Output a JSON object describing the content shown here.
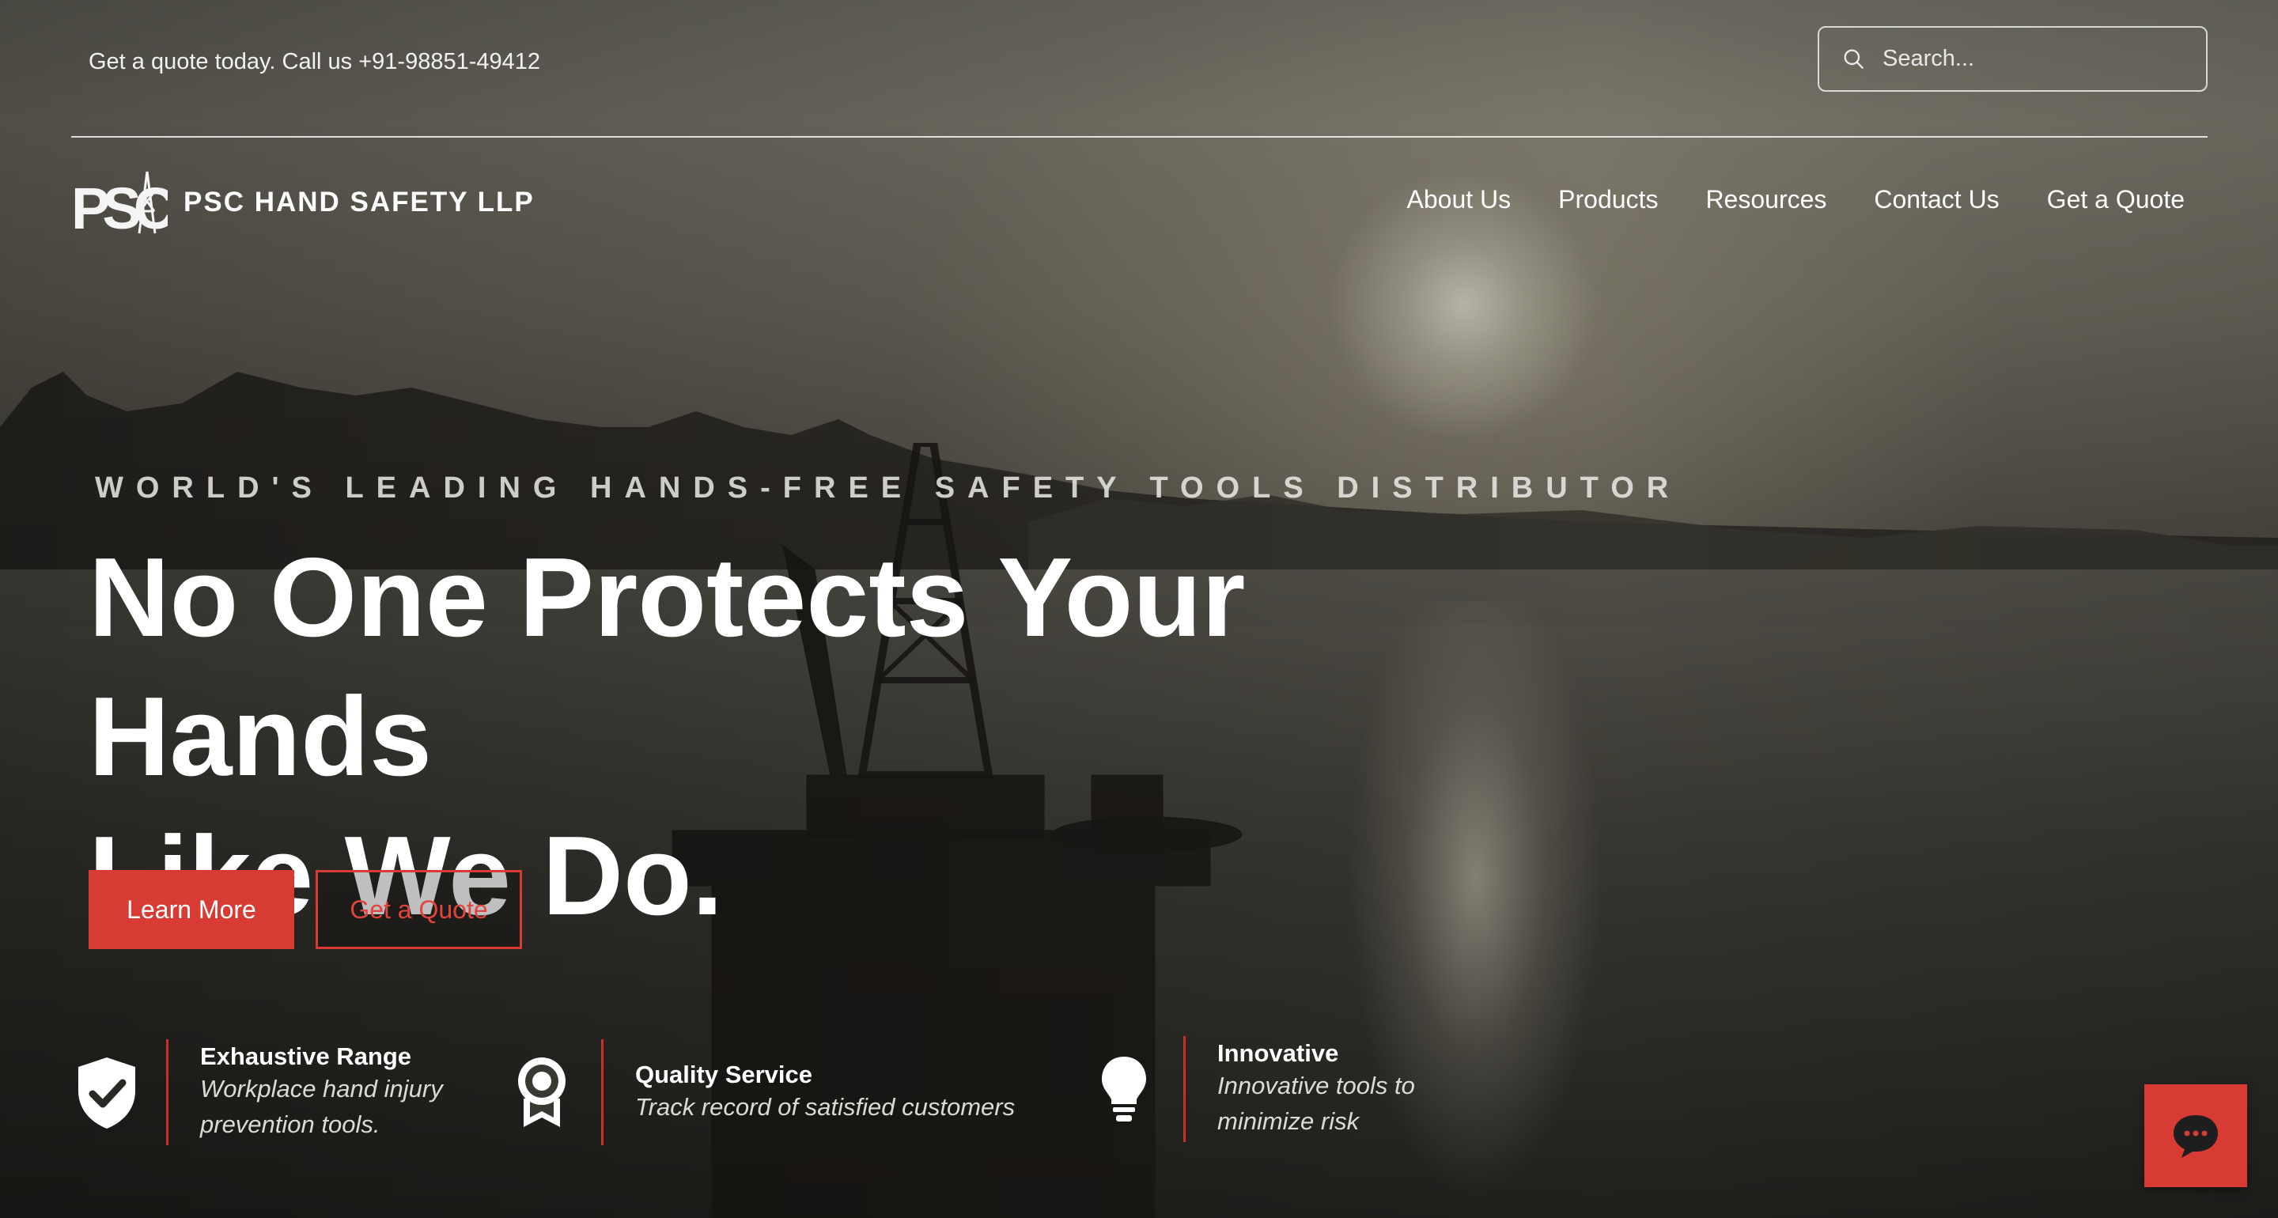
{
  "topbar": {
    "contact_text": "Get a quote today. Call us +91-98851-49412",
    "search_placeholder": "Search..."
  },
  "brand": {
    "logo_text": "PSC",
    "name": "PSC HAND SAFETY LLP"
  },
  "nav": {
    "items": [
      {
        "label": "About Us"
      },
      {
        "label": "Products"
      },
      {
        "label": "Resources"
      },
      {
        "label": "Contact Us"
      },
      {
        "label": "Get a Quote"
      }
    ]
  },
  "hero": {
    "eyebrow": "WORLD'S LEADING HANDS-FREE SAFETY TOOLS DISTRIBUTOR",
    "headline_line1": "No One Protects Your Hands",
    "headline_line2": "Like We Do.",
    "primary_button": "Learn More",
    "secondary_button": "Get a Quote"
  },
  "features": [
    {
      "icon": "shield-check-icon",
      "title": "Exhaustive Range",
      "desc_line1": "Workplace hand injury",
      "desc_line2": "prevention tools."
    },
    {
      "icon": "award-medal-icon",
      "title": "Quality Service",
      "desc_line1": "Track record of satisfied customers",
      "desc_line2": ""
    },
    {
      "icon": "lightbulb-icon",
      "title": "Innovative",
      "desc_line1": "Innovative tools to",
      "desc_line2": "minimize risk"
    }
  ],
  "chat": {
    "icon": "chat-bubble-icon"
  },
  "colors": {
    "accent": "#d73b34",
    "text": "#ffffff"
  }
}
